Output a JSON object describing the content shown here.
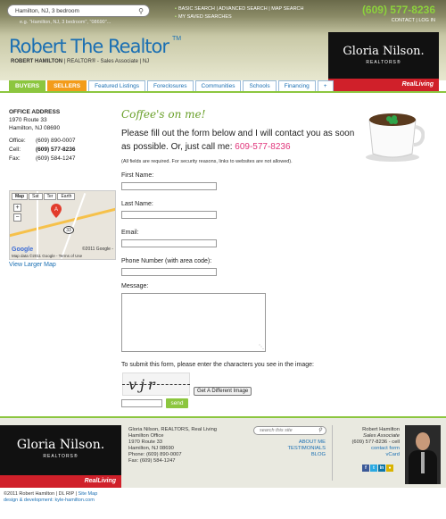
{
  "header": {
    "search_value": "Hamilton, NJ, 3 bedroom",
    "search_hint": "e.g. \"Hamilton, NJ, 3 bedroom\", \"08690\"...",
    "links": [
      "BASIC SEARCH",
      "ADVANCED SEARCH",
      "MAP SEARCH",
      "MY SAVED SEARCHES"
    ],
    "phone": "(609) 577-8236",
    "contact": "CONTACT",
    "login": "LOG IN",
    "separator": "|",
    "brand_title": "Robert The Realtor",
    "tm": "TM",
    "agent_name": "ROBERT HAMILTON",
    "agent_role": "REALTOR® - Sales Associate",
    "agent_state": "NJ"
  },
  "logo": {
    "name": "Gloria Nilson.",
    "realtors": "REALTORS®",
    "real_living": "RealLiving"
  },
  "nav": {
    "tabs": [
      "BUYERS",
      "SELLERS",
      "Featured Listings",
      "Foreclosures",
      "Communities",
      "Schools",
      "Financing",
      "+"
    ]
  },
  "sidebar": {
    "heading": "OFFICE ADDRESS",
    "address1": "1970 Route 33",
    "address2": "Hamilton, NJ 08690",
    "office_label": "Office:",
    "office": "(609) 890-0007",
    "cell_label": "Cell:",
    "cell": "(609) 577-8236",
    "fax_label": "Fax:",
    "fax": "(609) 584-1247",
    "map_types": [
      "Map",
      "Sat",
      "Ter",
      "Earth"
    ],
    "map_route": "33",
    "map_google": "Google",
    "map_copyright": "©2011 Google -",
    "map_data": "Map data ©2011 Google - Terms of Use",
    "larger_map": "View Larger Map"
  },
  "form": {
    "heading": "Coffee's on me!",
    "intro": "Please fill out the form below and I will contact you as soon as possible. Or, just call me:",
    "intro_phone": "609-577-8236",
    "notice": "(All fields are required. For security reasons, links to websites are not allowed).",
    "first_name": "First Name:",
    "last_name": "Last Name:",
    "email": "Email:",
    "phone": "Phone Number (with area code):",
    "message": "Message:",
    "captcha_label": "To submit this form, please enter the characters you see in the image:",
    "captcha_text": "vjr",
    "different_image": "Get A Different Image",
    "send": "send"
  },
  "footer": {
    "office_lines": [
      "Gloria Nilson, REALTORS, Real Living",
      "Hamilton Office",
      "1970 Route 33",
      "Hamilton, NJ 08690",
      "Phone: (609) 890-0007",
      "Fax: (609) 584-1247"
    ],
    "search_placeholder": "search this site",
    "links": [
      "ABOUT ME",
      "TESTIMONIALS",
      "BLOG"
    ],
    "agent_name": "Robert Hamilton",
    "agent_role": "Sales Associate",
    "agent_cell": "(609) 577-8236 - cell",
    "agent_links": [
      "contact form",
      "vCard"
    ],
    "copyright": "©2011 Robert Hamilton  |  DL RIP  |",
    "sitemap": "Site Map",
    "design": "design & development: kyle-hamilton.com"
  }
}
